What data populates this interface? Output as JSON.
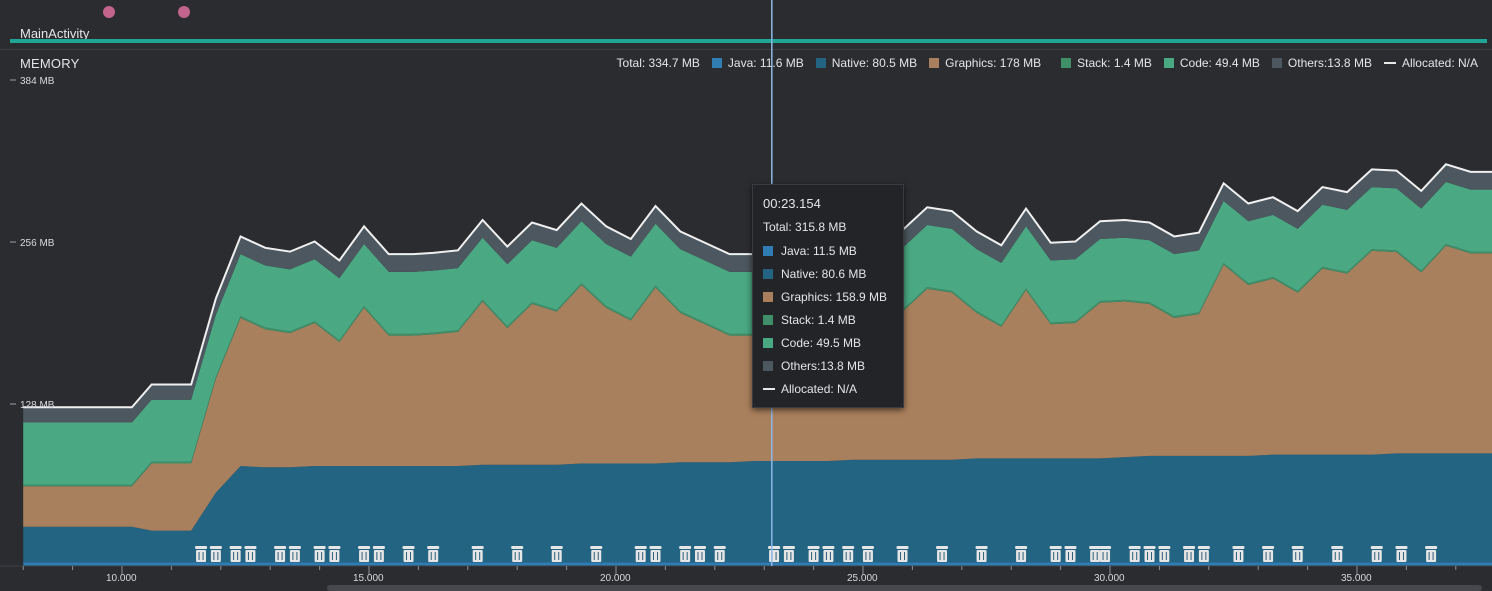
{
  "events": {
    "activity_name": "MainActivity"
  },
  "memory": {
    "title": "MEMORY",
    "legend": {
      "total": "Total: 334.7 MB",
      "java": "Java: 11.6 MB",
      "native": "Native: 80.5 MB",
      "graphics": "Graphics: 178 MB",
      "stack": "Stack: 1.4 MB",
      "code": "Code: 49.4 MB",
      "others": "Others:13.8 MB",
      "allocated": "Allocated: N/A"
    },
    "y_ticks": [
      "384 MB",
      "256 MB",
      "128 MB"
    ],
    "x_ticks": [
      "10.000",
      "15.000",
      "20.000",
      "25.000",
      "30.000",
      "35.000"
    ],
    "colors": {
      "java": "#2f7db3",
      "native": "#236482",
      "graphics": "#a9805d",
      "stack": "#3f8f68",
      "code": "#4aa883",
      "others": "#4c575f",
      "background": "#2b2c30",
      "cursor": "#8fb7e8"
    }
  },
  "tooltip": {
    "time": "00:23.154",
    "total": "Total: 315.8 MB",
    "rows": [
      {
        "label": "Java: 11.5 MB",
        "color": "#2f7db3"
      },
      {
        "label": "Native: 80.6 MB",
        "color": "#236482"
      },
      {
        "label": "Graphics: 158.9 MB",
        "color": "#a9805d"
      },
      {
        "label": "Stack: 1.4 MB",
        "color": "#3f8f68"
      },
      {
        "label": "Code: 49.5 MB",
        "color": "#4aa883"
      },
      {
        "label": "Others:13.8 MB",
        "color": "#4c575f"
      }
    ],
    "allocated": "Allocated: N/A"
  },
  "chart_data": {
    "type": "area",
    "title": "MEMORY",
    "xlabel": "",
    "ylabel": "",
    "x_unit": "seconds",
    "ylim": [
      0,
      384
    ],
    "x": [
      8.0,
      10.2,
      10.6,
      11.4,
      11.9,
      12.4,
      12.9,
      13.4,
      13.9,
      14.4,
      14.9,
      15.4,
      15.9,
      16.3,
      16.8,
      17.3,
      17.8,
      18.3,
      18.8,
      19.3,
      19.8,
      20.3,
      20.8,
      21.3,
      21.8,
      22.3,
      22.8,
      23.3,
      23.8,
      24.3,
      24.8,
      25.3,
      25.8,
      26.3,
      26.8,
      27.3,
      27.8,
      28.3,
      28.8,
      29.3,
      29.8,
      30.3,
      30.8,
      31.3,
      31.8,
      32.3,
      32.8,
      33.3,
      33.8,
      34.3,
      34.8,
      35.3,
      35.8,
      36.3,
      36.8,
      37.3,
      37.8
    ],
    "series": [
      {
        "name": "Java",
        "values": [
          3,
          3,
          3,
          3,
          3,
          3,
          3,
          3,
          3,
          3,
          3,
          3,
          3,
          3,
          3,
          3,
          3,
          3,
          3,
          3,
          3,
          3,
          3,
          3,
          3,
          3,
          3,
          3,
          3,
          3,
          3,
          3,
          3,
          3,
          3,
          3,
          3,
          3,
          3,
          3,
          3,
          3,
          3,
          3,
          3,
          3,
          3,
          3,
          3,
          3,
          3,
          3,
          3,
          3,
          3,
          3,
          3
        ]
      },
      {
        "name": "Native",
        "values": [
          28,
          28,
          25,
          25,
          55,
          76,
          75,
          75,
          76,
          76,
          76,
          76,
          76,
          76,
          76,
          77,
          77,
          77,
          77,
          78,
          78,
          78,
          78,
          79,
          79,
          79,
          80,
          80,
          80,
          80,
          81,
          81,
          81,
          81,
          81,
          82,
          82,
          82,
          82,
          82,
          82,
          83,
          84,
          84,
          84,
          84,
          84,
          85,
          85,
          85,
          85,
          85,
          86,
          86,
          86,
          86,
          86
        ]
      },
      {
        "name": "Graphics",
        "values": [
          32,
          32,
          53,
          53,
          90,
          117,
          109,
          106,
          113,
          98,
          125,
          103,
          103,
          104,
          106,
          129,
          108,
          127,
          121,
          141,
          123,
          113,
          139,
          118,
          109,
          100,
          99,
          100,
          113,
          129,
          136,
          107,
          117,
          135,
          132,
          115,
          104,
          133,
          106,
          107,
          123,
          123,
          120,
          109,
          112,
          151,
          135,
          139,
          128,
          147,
          143,
          161,
          159,
          143,
          164,
          158,
          158
        ]
      },
      {
        "name": "Stack",
        "values": [
          1.4,
          1.4,
          1.4,
          1.4,
          1.4,
          1.4,
          1.4,
          1.4,
          1.4,
          1.4,
          1.4,
          1.4,
          1.4,
          1.4,
          1.4,
          1.4,
          1.4,
          1.4,
          1.4,
          1.4,
          1.4,
          1.4,
          1.4,
          1.4,
          1.4,
          1.4,
          1.4,
          1.4,
          1.4,
          1.4,
          1.4,
          1.4,
          1.4,
          1.4,
          1.4,
          1.4,
          1.4,
          1.4,
          1.4,
          1.4,
          1.4,
          1.4,
          1.4,
          1.4,
          1.4,
          1.4,
          1.4,
          1.4,
          1.4,
          1.4,
          1.4,
          1.4,
          1.4,
          1.4,
          1.4,
          1.4,
          1.4
        ]
      },
      {
        "name": "Code",
        "values": [
          49,
          49,
          49,
          49,
          49,
          49,
          49,
          49,
          49,
          49,
          49,
          49,
          49,
          49,
          49,
          49,
          49,
          49,
          49,
          49,
          49,
          49,
          49,
          49,
          49,
          49,
          49,
          49,
          49,
          49,
          49,
          49,
          49,
          49,
          49,
          49,
          49,
          49,
          49,
          49,
          49,
          49,
          49,
          49,
          49,
          49,
          49,
          49,
          49,
          49,
          49,
          49,
          49,
          49,
          49,
          49,
          49
        ]
      },
      {
        "name": "Others",
        "values": [
          12,
          12,
          12,
          12,
          13,
          14,
          14,
          14,
          14,
          14,
          14,
          14,
          14,
          14,
          14,
          14,
          14,
          14,
          14,
          14,
          14,
          14,
          14,
          14,
          14,
          14,
          14,
          14,
          14,
          14,
          14,
          14,
          14,
          14,
          14,
          14,
          14,
          14,
          14,
          14,
          14,
          14,
          14,
          14,
          14,
          14,
          14,
          14,
          14,
          14,
          14,
          14,
          14,
          14,
          14,
          14,
          14
        ]
      }
    ],
    "cursor_x": 23.154,
    "gc_events": [
      11.6,
      11.9,
      12.3,
      12.6,
      13.2,
      13.5,
      14.0,
      14.3,
      14.9,
      15.2,
      15.8,
      16.3,
      17.2,
      18.0,
      18.8,
      19.6,
      20.5,
      20.8,
      21.4,
      21.7,
      22.1,
      23.2,
      23.5,
      24.0,
      24.3,
      24.7,
      25.1,
      25.8,
      26.6,
      27.4,
      28.2,
      28.9,
      29.2,
      29.7,
      29.9,
      30.5,
      30.8,
      31.1,
      31.6,
      31.9,
      32.6,
      33.2,
      33.8,
      34.6,
      35.4,
      35.9,
      36.5
    ]
  }
}
